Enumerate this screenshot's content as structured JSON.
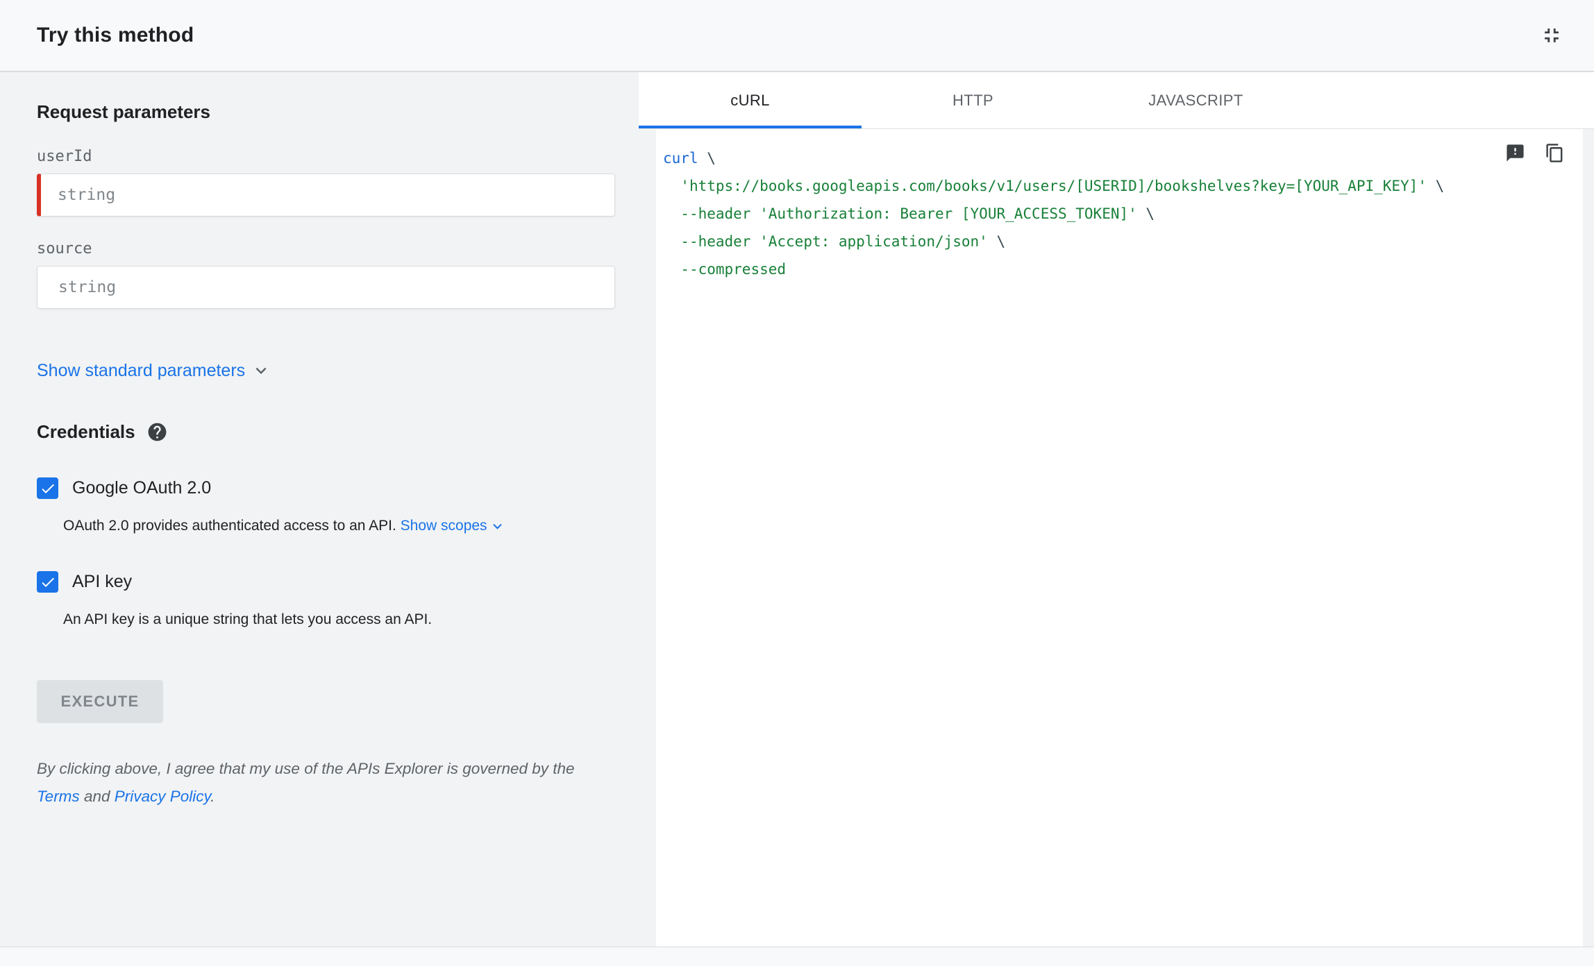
{
  "header": {
    "title": "Try this method"
  },
  "params": {
    "section_title": "Request parameters",
    "fields": [
      {
        "label": "userId",
        "placeholder": "string",
        "required": true
      },
      {
        "label": "source",
        "placeholder": "string",
        "required": false
      }
    ],
    "show_standard_label": "Show standard parameters"
  },
  "credentials": {
    "section_title": "Credentials",
    "oauth": {
      "label": "Google OAuth 2.0",
      "checked": true,
      "description": "OAuth 2.0 provides authenticated access to an API.",
      "show_scopes_label": "Show scopes"
    },
    "api_key": {
      "label": "API key",
      "checked": true,
      "description": "An API key is a unique string that lets you access an API."
    }
  },
  "execute": {
    "label": "EXECUTE"
  },
  "disclaimer": {
    "prefix": "By clicking above, I agree that my use of the APIs Explorer is governed by the ",
    "terms": "Terms",
    "middle": " and ",
    "privacy": "Privacy Policy",
    "suffix": "."
  },
  "tabs": [
    {
      "label": "cURL",
      "active": true
    },
    {
      "label": "HTTP",
      "active": false
    },
    {
      "label": "JAVASCRIPT",
      "active": false
    }
  ],
  "code": {
    "lines": [
      [
        {
          "t": "curl",
          "c": "keyword"
        },
        {
          "t": " \\",
          "c": "plain"
        }
      ],
      [
        {
          "t": "  ",
          "c": "plain"
        },
        {
          "t": "'https://books.googleapis.com/books/v1/users/[USERID]/bookshelves?key=[YOUR_API_KEY]'",
          "c": "string"
        },
        {
          "t": " \\",
          "c": "plain"
        }
      ],
      [
        {
          "t": "  ",
          "c": "plain"
        },
        {
          "t": "--header",
          "c": "flag"
        },
        {
          "t": " ",
          "c": "plain"
        },
        {
          "t": "'Authorization: Bearer [YOUR_ACCESS_TOKEN]'",
          "c": "string"
        },
        {
          "t": " \\",
          "c": "plain"
        }
      ],
      [
        {
          "t": "  ",
          "c": "plain"
        },
        {
          "t": "--header",
          "c": "flag"
        },
        {
          "t": " ",
          "c": "plain"
        },
        {
          "t": "'Accept: application/json'",
          "c": "string"
        },
        {
          "t": " \\",
          "c": "plain"
        }
      ],
      [
        {
          "t": "  ",
          "c": "plain"
        },
        {
          "t": "--compressed",
          "c": "flag"
        }
      ]
    ]
  },
  "colors": {
    "accent": "#1a73e8",
    "required": "#d93025",
    "code_keyword": "#1967d2",
    "code_string": "#188038",
    "code_flag": "#188038",
    "code_plain": "#37474f"
  }
}
